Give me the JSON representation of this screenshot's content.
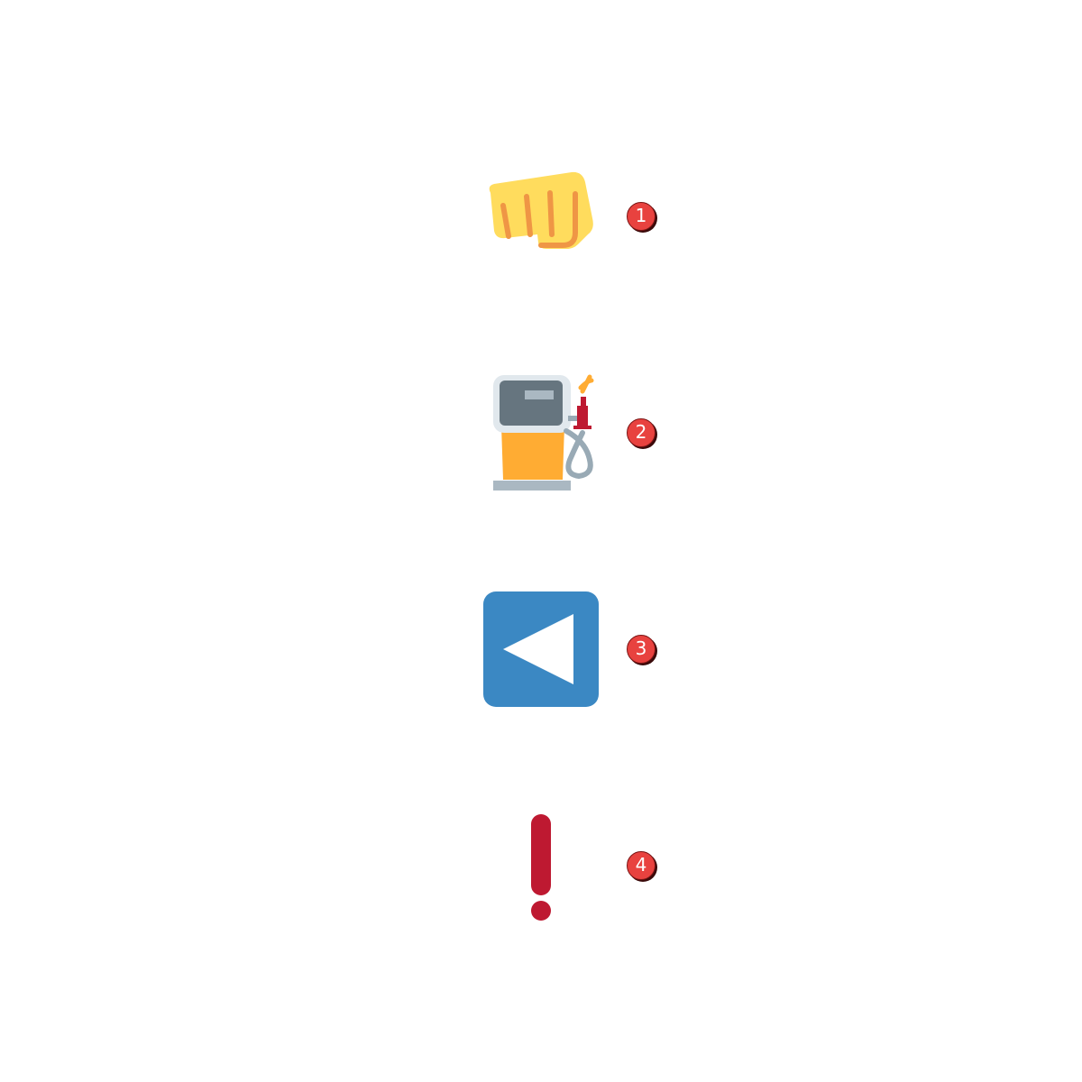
{
  "items": [
    {
      "label": "1",
      "icon": "oncoming-fist-icon"
    },
    {
      "label": "2",
      "icon": "fuel-pump-icon"
    },
    {
      "label": "3",
      "icon": "reverse-button-icon"
    },
    {
      "label": "4",
      "icon": "exclamation-mark-icon"
    }
  ],
  "colors": {
    "badge": "#e8423f",
    "fist": "#ffdc5d",
    "fist_lines": "#ef9645",
    "pump_body": "#ffac33",
    "pump_head": "#e1e8ed",
    "pump_screen": "#66757f",
    "pump_nozzle": "#be1931",
    "reverse_bg": "#3b88c3",
    "exclamation": "#be1931"
  }
}
